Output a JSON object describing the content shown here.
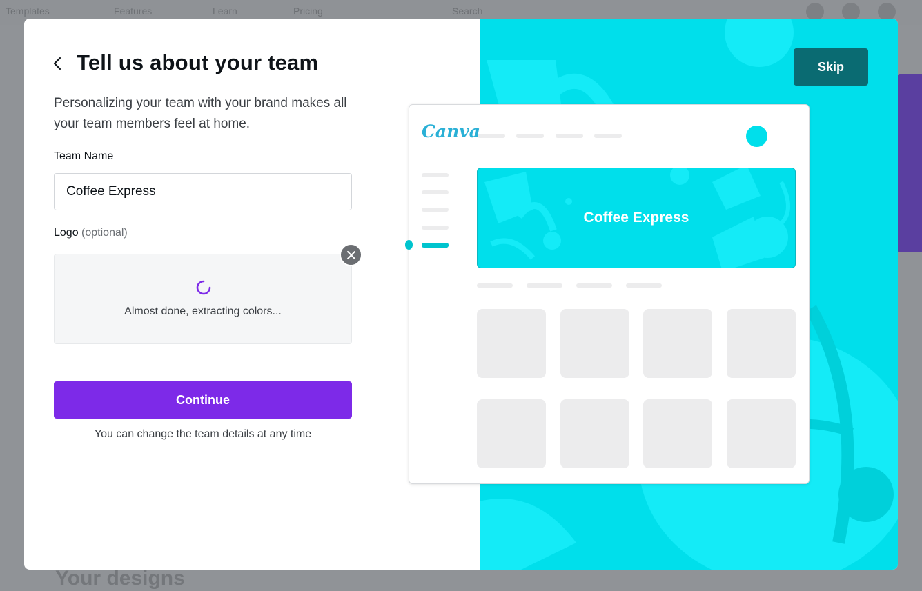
{
  "background": {
    "nav_items": [
      "Templates",
      "Features",
      "Learn",
      "Pricing"
    ],
    "search_placeholder": "Search",
    "heading": "Your designs"
  },
  "modal": {
    "title": "Tell us about your team",
    "description": "Personalizing your team with your brand makes all your team members feel at home.",
    "team_name_label": "Team Name",
    "team_name_value": "Coffee Express",
    "logo_label": "Logo",
    "logo_optional": "(optional)",
    "logo_status": "Almost done, extracting colors...",
    "continue_label": "Continue",
    "footnote": "You can change the team details at any time"
  },
  "preview_panel": {
    "skip_label": "Skip",
    "brand": "Canva",
    "banner_text": "Coffee Express"
  },
  "colors": {
    "accent": "#7d2ae8",
    "panel": "#00dfeb",
    "skip": "#0a6b72"
  }
}
